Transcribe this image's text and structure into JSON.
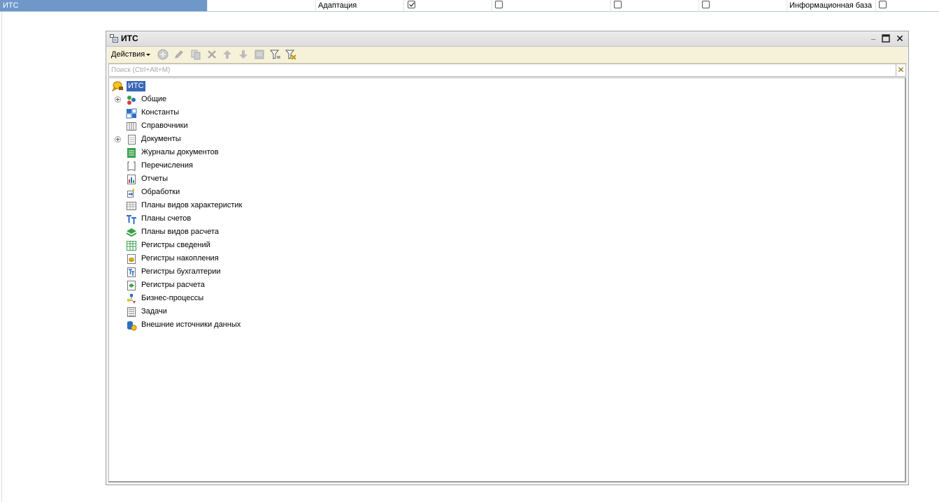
{
  "top_row": {
    "name_value": "ИТС",
    "mode_value": "Адаптация",
    "check_1": true,
    "check_2": false,
    "check_3": false,
    "check_4": false,
    "infobase_label": "Информационная база",
    "check_5": false
  },
  "window": {
    "title": "ИТС",
    "minimize_glyph": "_",
    "maximize_glyph": "☐",
    "close_glyph": "✕"
  },
  "toolbar": {
    "actions_label": "Действия",
    "icons": [
      "add-icon",
      "edit-icon",
      "copy-icon",
      "delete-icon",
      "move-up-icon",
      "move-down-icon",
      "list-icon",
      "filter-icon",
      "clear-filter-icon"
    ]
  },
  "search": {
    "placeholder": "Поиск (Ctrl+Alt+M)",
    "clear_glyph": "✕"
  },
  "tree": {
    "root_label": "ИТС",
    "items": [
      {
        "label": "Общие",
        "icon": "common-icon",
        "expandable": true
      },
      {
        "label": "Константы",
        "icon": "constants-icon",
        "expandable": false
      },
      {
        "label": "Справочники",
        "icon": "catalogs-icon",
        "expandable": false
      },
      {
        "label": "Документы",
        "icon": "documents-icon",
        "expandable": true
      },
      {
        "label": "Журналы документов",
        "icon": "document-journals-icon",
        "expandable": false
      },
      {
        "label": "Перечисления",
        "icon": "enums-icon",
        "expandable": false
      },
      {
        "label": "Отчеты",
        "icon": "reports-icon",
        "expandable": false
      },
      {
        "label": "Обработки",
        "icon": "data-processors-icon",
        "expandable": false
      },
      {
        "label": "Планы видов характеристик",
        "icon": "chart-of-characteristics-icon",
        "expandable": false
      },
      {
        "label": "Планы счетов",
        "icon": "chart-of-accounts-icon",
        "expandable": false
      },
      {
        "label": "Планы видов расчета",
        "icon": "chart-of-calculation-icon",
        "expandable": false
      },
      {
        "label": "Регистры сведений",
        "icon": "info-registers-icon",
        "expandable": false
      },
      {
        "label": "Регистры накопления",
        "icon": "accumulation-registers-icon",
        "expandable": false
      },
      {
        "label": "Регистры бухгалтерии",
        "icon": "accounting-registers-icon",
        "expandable": false
      },
      {
        "label": "Регистры расчета",
        "icon": "calculation-registers-icon",
        "expandable": false
      },
      {
        "label": "Бизнес-процессы",
        "icon": "business-processes-icon",
        "expandable": false
      },
      {
        "label": "Задачи",
        "icon": "tasks-icon",
        "expandable": false
      },
      {
        "label": "Внешние источники данных",
        "icon": "external-data-sources-icon",
        "expandable": false
      }
    ]
  },
  "colors": {
    "selection": "#3a68b6",
    "top_selection": "#6f98c9",
    "toolbar_bg": "#f6f2d9"
  }
}
